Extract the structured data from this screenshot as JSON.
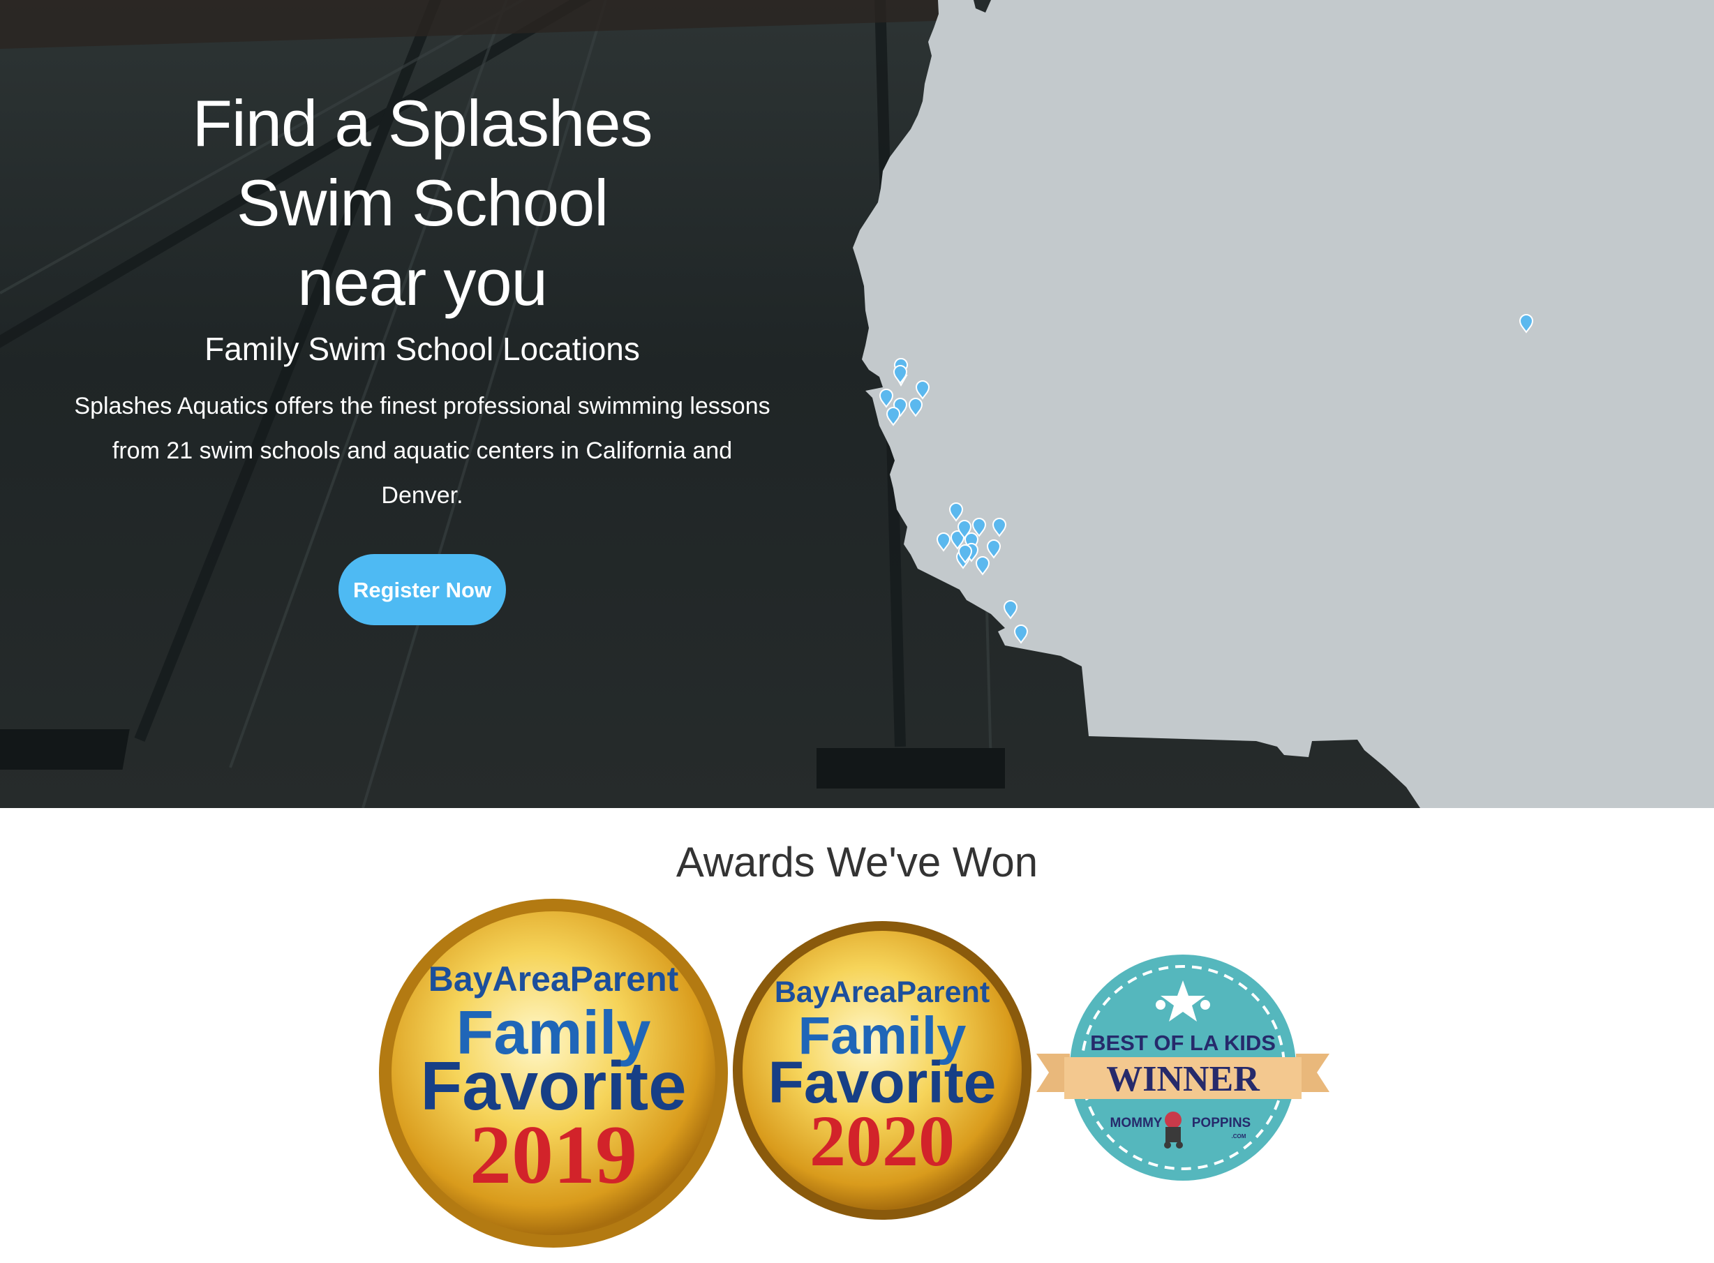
{
  "hero": {
    "title_lines": [
      "Find a Splashes",
      "Swim School",
      "near you"
    ],
    "subtitle": "Family Swim School Locations",
    "description": "Splashes Aquatics offers the finest professional swimming lessons from 21 swim schools and aquatic centers in California and Denver.",
    "cta_label": "Register Now"
  },
  "map": {
    "marker_icon": "map-pin-icon",
    "marker_color": "#5bb8ee",
    "land_color": "#c3c9cc",
    "marker_count": 21
  },
  "awards": {
    "title": "Awards We've Won",
    "badges": [
      {
        "publisher": "BayAreaParent",
        "line1": "Family",
        "line2": "Favorite",
        "year": "2019"
      },
      {
        "publisher": "BayAreaParent",
        "line1": "Family",
        "line2": "Favorite",
        "year": "2020"
      },
      {
        "top": "BEST OF LA KIDS",
        "ribbon": "WINNER",
        "brand_left": "MOMMY",
        "brand_right": "POPPINS",
        "brand_small": ".COM"
      }
    ]
  },
  "colors": {
    "accent": "#4ebaf3",
    "hero_overlay": "#252b2c",
    "gold": "#e7b52c",
    "badge_blue": "#1c4f9c",
    "badge_red": "#d2232a",
    "la_teal": "#55b7bd"
  }
}
